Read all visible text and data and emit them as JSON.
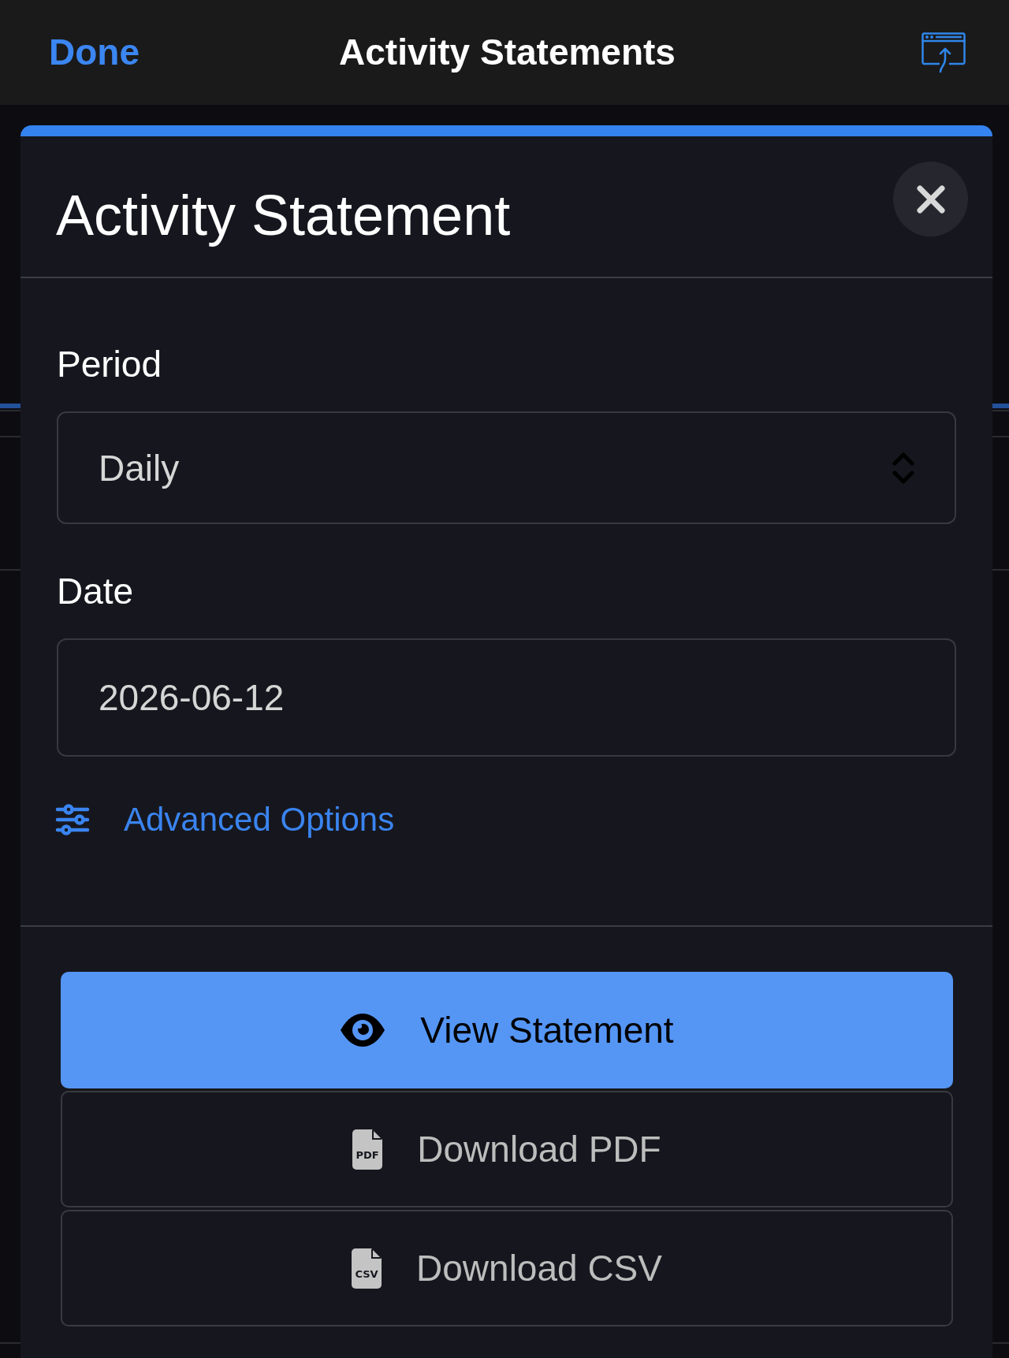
{
  "nav_bar": {
    "done": "Done",
    "title": "Activity Statements"
  },
  "modal": {
    "title": "Activity Statement",
    "fields": [
      {
        "kind": "select",
        "label": "Period",
        "value": "Daily"
      },
      {
        "kind": "text",
        "label": "Date",
        "value": "2026-06-12"
      }
    ],
    "advanced_link": "Advanced Options",
    "buttons": [
      {
        "kind": "view",
        "label": "View Statement"
      },
      {
        "kind": "download",
        "label": "Download PDF",
        "badge": "PDF"
      },
      {
        "kind": "download",
        "label": "Download CSV",
        "badge": "CSV"
      }
    ]
  }
}
